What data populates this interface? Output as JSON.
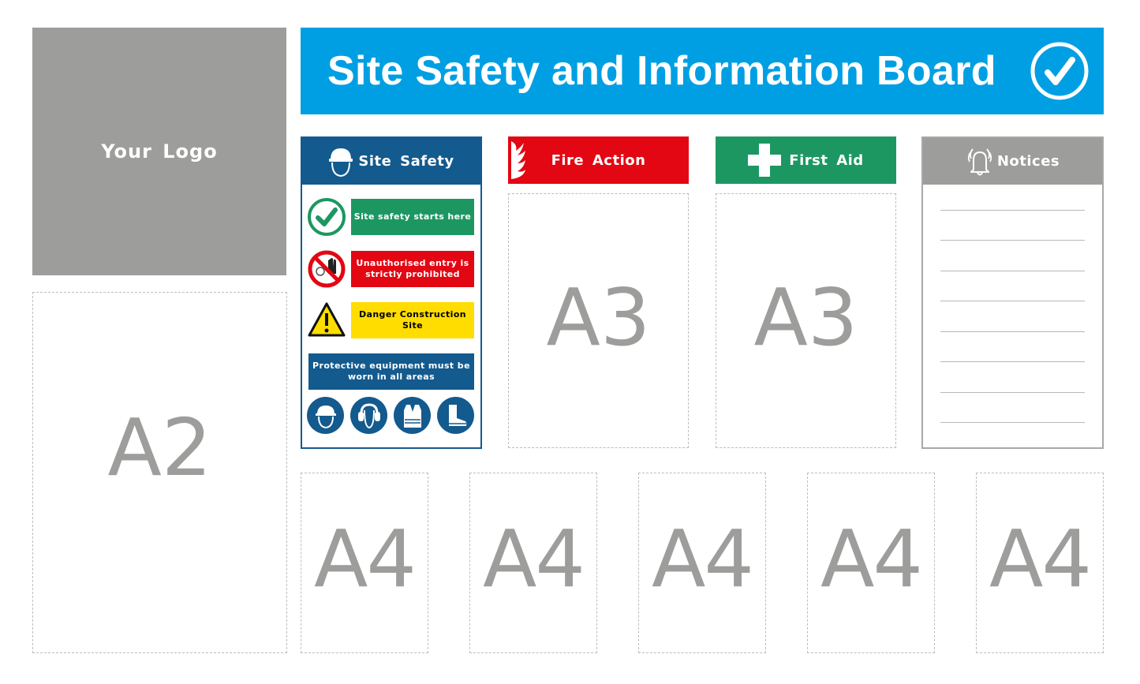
{
  "logo": {
    "label": "Your Logo"
  },
  "banner": {
    "title": "Site Safety and Information Board",
    "icon": "check-circle-icon",
    "color": "#009fe3"
  },
  "site_safety": {
    "header": "Site Safety",
    "header_icon": "hard-hat-head-icon",
    "color": "#135a8e",
    "signs": [
      {
        "icon": "check-circle-icon",
        "text": "Site safety starts here",
        "bg": "#1d9762",
        "fg": "#ffffff"
      },
      {
        "icon": "no-entry-hand-icon",
        "text": "Unauthorised entry is strictly prohibited",
        "bg": "#e30613",
        "fg": "#ffffff"
      },
      {
        "icon": "warning-triangle-icon",
        "text": "Danger Construction Site",
        "bg": "#ffdd00",
        "fg": "#000000"
      }
    ],
    "ppe_notice": "Protective equipment must be worn in all areas",
    "ppe_icons": [
      "hard-hat-icon",
      "ear-defenders-icon",
      "hi-vis-vest-icon",
      "safety-boots-icon"
    ]
  },
  "fire_action": {
    "header": "Fire Action",
    "icon": "flame-icon",
    "color": "#e30613",
    "slot": "A3"
  },
  "first_aid": {
    "header": "First Aid",
    "icon": "cross-icon",
    "color": "#1d9762",
    "slot": "A3"
  },
  "notices": {
    "header": "Notices",
    "icon": "bell-icon",
    "color": "#9d9d9c",
    "line_count": 8
  },
  "a2_slot": {
    "label": "A2"
  },
  "a4_slots": [
    {
      "label": "A4"
    },
    {
      "label": "A4"
    },
    {
      "label": "A4"
    },
    {
      "label": "A4"
    },
    {
      "label": "A4"
    }
  ]
}
